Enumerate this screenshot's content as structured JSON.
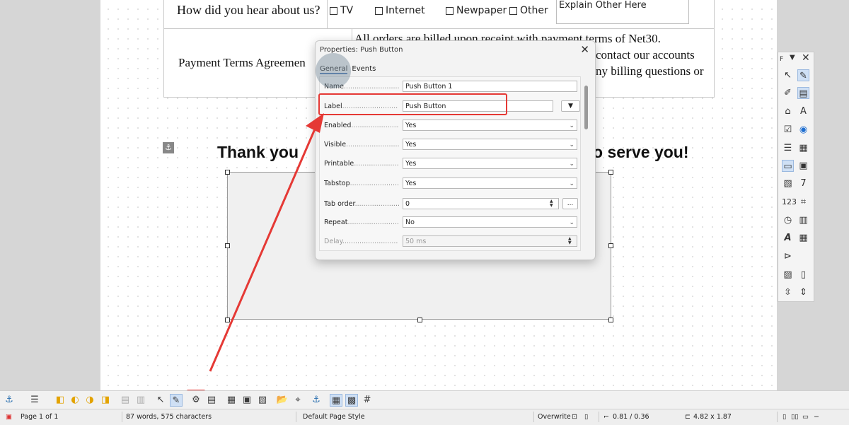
{
  "document": {
    "question": "How did you hear about us?",
    "options": [
      "TV",
      "Internet",
      "Newpaper",
      "Other"
    ],
    "explain_placeholder": "Explain Other Here",
    "payment_label": "Payment Terms Agreemen",
    "payment_lines": [
      "All orders are billed upon receipt with payment terms of Net30.",
      "contact our accounts",
      "ny billing questions or"
    ],
    "thank_left": "Thank you",
    "thank_right": "o serve you!",
    "anchor_icon": "anchor-icon"
  },
  "dialog": {
    "title": "Properties: Push Button",
    "close_glyph": "✕",
    "tabs": [
      "General",
      "Events"
    ],
    "fields": [
      {
        "label": "Name",
        "value": "Push Button 1"
      },
      {
        "label": "Label",
        "value": "Push Button"
      },
      {
        "label": "Enabled",
        "value": "Yes"
      },
      {
        "label": "Visible",
        "value": "Yes"
      },
      {
        "label": "Printable",
        "value": "Yes"
      },
      {
        "label": "Tabstop",
        "value": "Yes"
      },
      {
        "label": "Tab order",
        "value": "0"
      },
      {
        "label": "Repeat",
        "value": "No"
      },
      {
        "label": "Delay",
        "value": "50 ms"
      }
    ],
    "more_button": "...",
    "label_dropdown_glyph": "▼"
  },
  "sidebar": {
    "header_letter": "F"
  },
  "status": {
    "page": "Page 1 of 1",
    "words": "87 words, 575 characters",
    "page_style": "Default Page Style",
    "mode": "Overwrite",
    "position": "0.81 / 0.36",
    "size": "4.82 x 1.87"
  },
  "colors": {
    "highlight": "#e53935",
    "accent": "#4f7ab3"
  }
}
